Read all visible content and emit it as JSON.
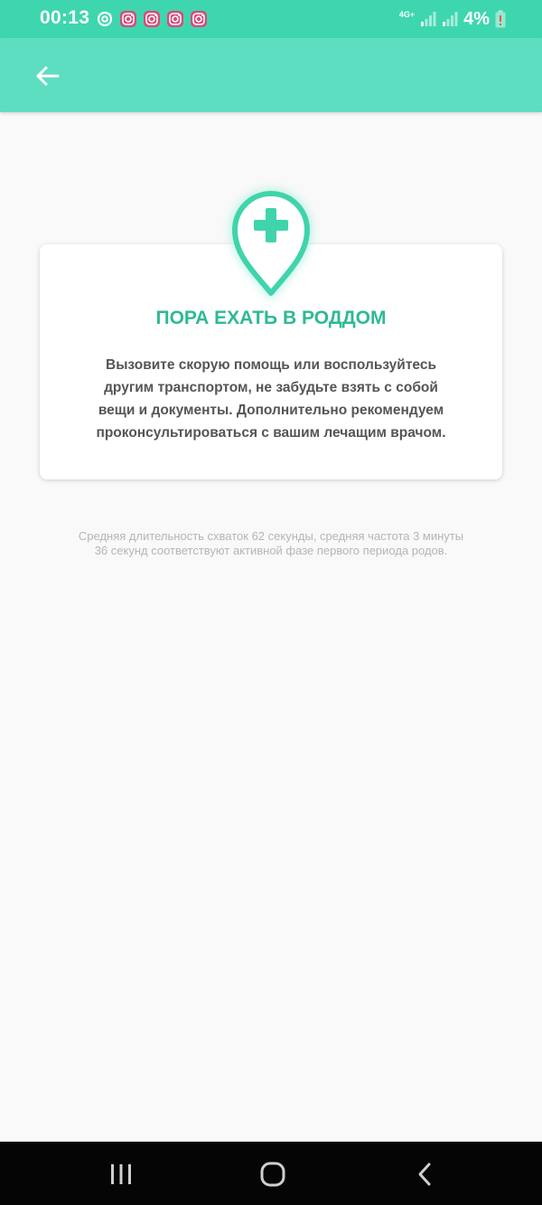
{
  "status_bar": {
    "time": "00:13",
    "network": "4G+",
    "battery": "4%",
    "notification_icons": [
      "sync-icon",
      "instagram-icon",
      "instagram-icon",
      "instagram-icon",
      "instagram-icon"
    ]
  },
  "app_bar": {
    "back_icon": "arrow-back-icon"
  },
  "card": {
    "icon": "hospital-pin-icon",
    "title": "ПОРА ЕХАТЬ В РОДДОМ",
    "body_lines": [
      "Вызовите скорую помощь или воспользуйтесь",
      "другим транспортом, не забудьте взять с собой",
      "вещи и документы. Дополнительно рекомендуем",
      "проконсультироваться с вашим лечащим врачом."
    ]
  },
  "note": {
    "lines": [
      "Средняя длительность схваток 62 секунды, средняя частота 3 минуты",
      "36 секунд соответствуют активной фазе первого периода родов."
    ]
  },
  "nav_bar": {
    "buttons": [
      "recent-apps-icon",
      "home-icon",
      "back-icon"
    ]
  },
  "colors": {
    "status_bar": "#3ed6ae",
    "app_bar": "#5ddec0",
    "accent": "#2fb996",
    "background": "#f9f9f9"
  }
}
